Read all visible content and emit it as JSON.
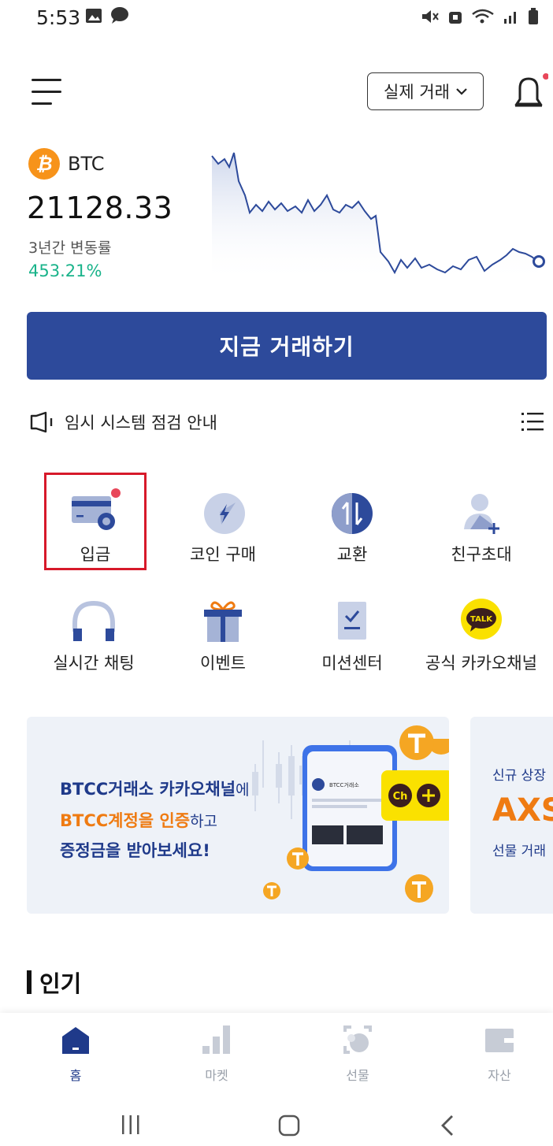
{
  "status_bar": {
    "time": "5:53"
  },
  "header": {
    "mode_selector": "실제 거래",
    "notification_dot_color": "#e8475a"
  },
  "ticker": {
    "symbol": "BTC",
    "price": "21128.33",
    "change_label": "3년간 변동률",
    "change_value": "453.21%",
    "change_color": "#19b38a"
  },
  "trade_button": {
    "label": "지금 거래하기",
    "color": "#2d4a9b"
  },
  "notice": {
    "text": "임시 시스템 점검 안내"
  },
  "quick_menu": {
    "row1": [
      {
        "label": "입금",
        "icon": "deposit-card-icon"
      },
      {
        "label": "코인 구매",
        "icon": "lightning-coin-icon"
      },
      {
        "label": "교환",
        "icon": "exchange-arrows-icon"
      },
      {
        "label": "친구초대",
        "icon": "invite-friend-icon"
      }
    ],
    "row2": [
      {
        "label": "실시간 채팅",
        "icon": "headset-icon"
      },
      {
        "label": "이벤트",
        "icon": "gift-icon"
      },
      {
        "label": "미션센터",
        "icon": "mission-clipboard-icon"
      },
      {
        "label": "공식 카카오채널",
        "icon": "kakao-talk-icon"
      }
    ]
  },
  "banners": [
    {
      "line1_bold": "BTCC거래소 카카오채널",
      "line1_rest": "에",
      "line2_bold": "BTCC계정을 인증",
      "line2_rest": "하고",
      "line3": "증정금을 받아보세요!",
      "phone_app_title": "BTCC거래소",
      "badge_text": "Ch",
      "talk_text": "TALK"
    },
    {
      "line1": "신규 상장",
      "line2": "AXS",
      "line3": "선물 거래"
    }
  ],
  "section": {
    "popular_title": "인기"
  },
  "bottom_nav": {
    "items": [
      {
        "label": "홈",
        "icon": "home-icon",
        "active": true
      },
      {
        "label": "마켓",
        "icon": "market-bars-icon",
        "active": false
      },
      {
        "label": "선물",
        "icon": "futures-icon",
        "active": false
      },
      {
        "label": "자산",
        "icon": "wallet-icon",
        "active": false
      }
    ],
    "active_color": "#1f3a8a"
  },
  "colors": {
    "brand_blue": "#2d4a9b",
    "accent_orange": "#ef7b12",
    "highlight_red": "#d7192a"
  }
}
